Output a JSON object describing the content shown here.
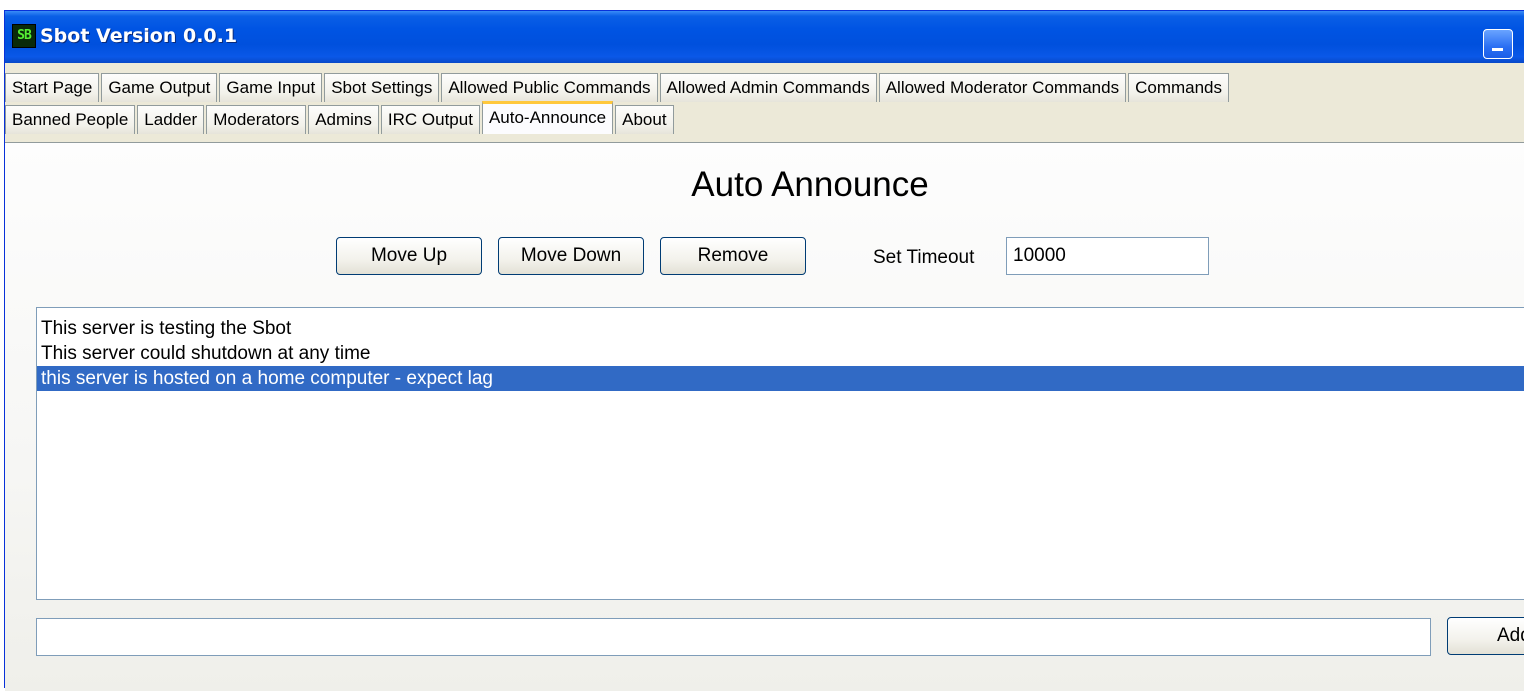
{
  "window": {
    "title": "Sbot Version 0.0.1",
    "app_icon": "SB"
  },
  "tabs_row1": [
    "Start Page",
    "Game Output",
    "Game Input",
    "Sbot Settings",
    "Allowed Public Commands",
    "Allowed Admin Commands",
    "Allowed Moderator Commands",
    "Commands"
  ],
  "tabs_row2": [
    "Banned People",
    "Ladder",
    "Moderators",
    "Admins",
    "IRC Output",
    "Auto-Announce",
    "About"
  ],
  "active_tab": "Auto-Announce",
  "panel": {
    "heading": "Auto Announce",
    "move_up_label": "Move Up",
    "move_down_label": "Move Down",
    "remove_label": "Remove",
    "timeout_label": "Set Timeout",
    "timeout_value": "10000",
    "announcements": [
      "This server is testing the Sbot",
      "This server could shutdown at any time",
      "this server is hosted on a home computer - expect lag"
    ],
    "selected_index": 2,
    "new_announcement_value": "",
    "add_label": "Add"
  },
  "colors": {
    "titlebar": "#0054e3",
    "selection": "#316ac5",
    "active_tab_accent": "#ffc83c"
  }
}
